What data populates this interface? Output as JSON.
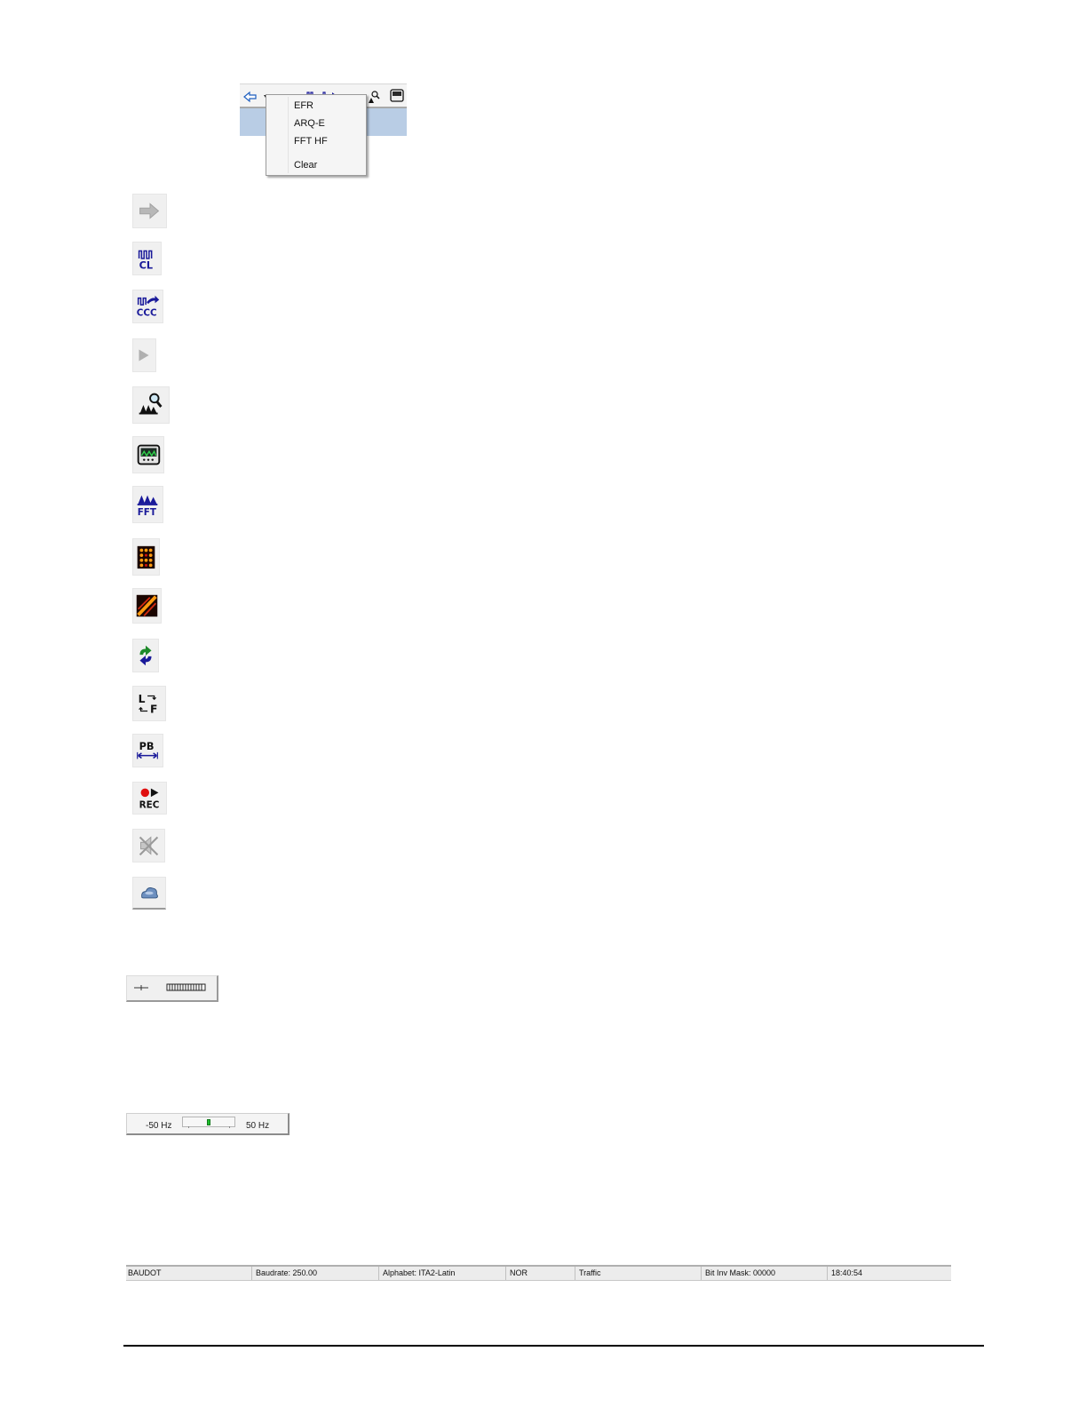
{
  "toolbar": {
    "dropdown_menu": {
      "items": [
        "EFR",
        "ARQ-E",
        "FFT HF"
      ],
      "clear_label": "Clear"
    }
  },
  "icons": [
    {
      "name": "forward-arrow-icon",
      "state": "disabled"
    },
    {
      "name": "cl-icon",
      "text": "CL"
    },
    {
      "name": "ccc-icon",
      "text": "CCC"
    },
    {
      "name": "play-icon",
      "state": "disabled"
    },
    {
      "name": "signal-search-icon"
    },
    {
      "name": "scope-display-icon"
    },
    {
      "name": "fft-icon",
      "text": "FFT"
    },
    {
      "name": "dot-matrix-icon"
    },
    {
      "name": "diagonal-waterfall-icon"
    },
    {
      "name": "swap-arrows-icon"
    },
    {
      "name": "lf-icon",
      "text": "L F"
    },
    {
      "name": "pb-icon",
      "text": "PB"
    },
    {
      "name": "rec-icon",
      "text": "REC"
    },
    {
      "name": "mute-speaker-icon",
      "state": "disabled"
    },
    {
      "name": "cloud-icon"
    }
  ],
  "tuning_indicator": {
    "left_label": "-50 Hz",
    "right_label": "50 Hz",
    "offset_hz": 0
  },
  "statusbar": {
    "mode": "BAUDOT",
    "baudrate": "Baudrate: 250.00",
    "alphabet": "Alphabet: ITA2-Latin",
    "polarity": "NOR",
    "state": "Traffic",
    "bit_inv_mask": "Bit Inv Mask: 00000",
    "time": "18:40:54"
  },
  "colors": {
    "icon_blue": "#1a1a9a",
    "icon_green": "#1e8a2a",
    "rec_red": "#e01010",
    "menu_highlight": "#b9cde5"
  }
}
